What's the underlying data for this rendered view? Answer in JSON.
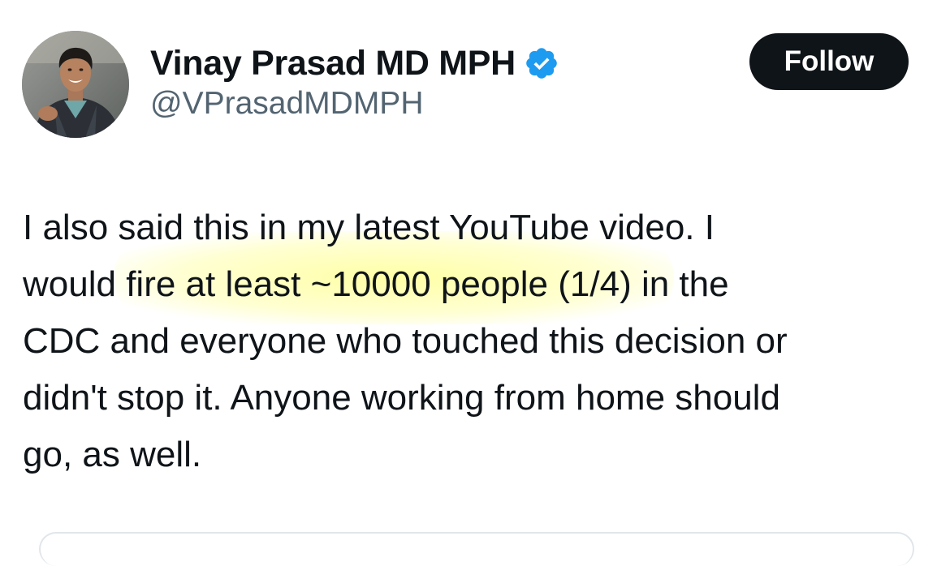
{
  "tweet": {
    "author": {
      "display_name": "Vinay Prasad MD MPH",
      "handle": "@VPrasadMDMPH",
      "verified": true,
      "verified_icon": "verified-badge-icon",
      "verified_color": "#1d9bf0"
    },
    "follow_label": "Follow",
    "text_lines": [
      "I also said this in my latest YouTube video. I",
      "would fire at least ~10000 people (1/4) in the",
      "CDC and everyone who touched this decision or",
      "didn't stop it.  Anyone working from home should",
      "go, as well."
    ]
  },
  "colors": {
    "text": "#0f1419",
    "secondary_text": "#536471",
    "button_bg": "#0f1419",
    "button_text": "#ffffff",
    "highlight": "#ffff99"
  }
}
